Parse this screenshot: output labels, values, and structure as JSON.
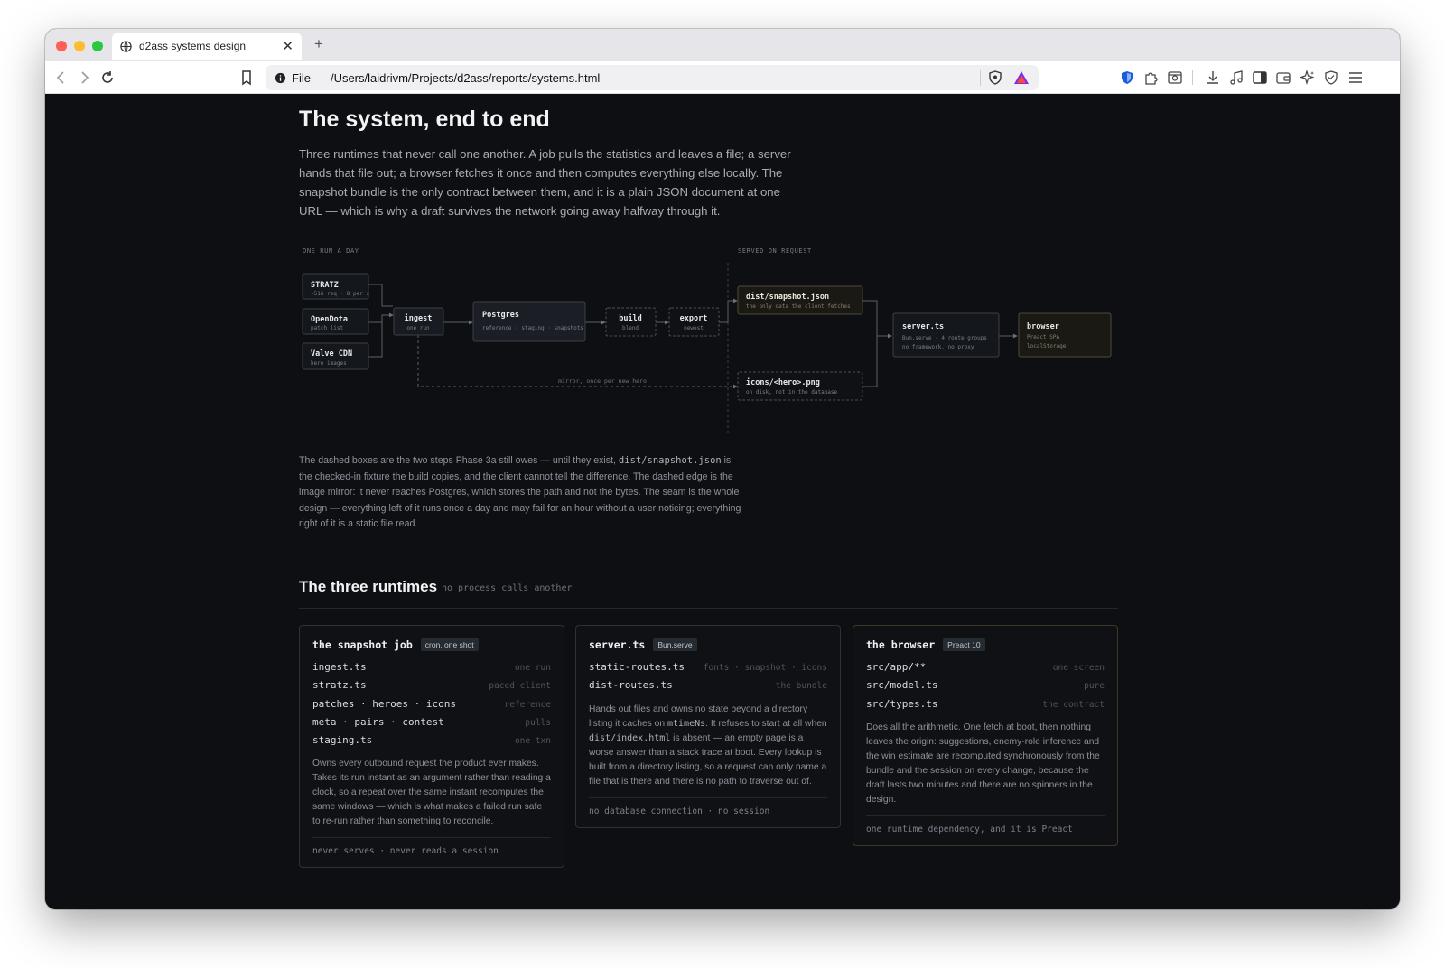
{
  "browser": {
    "tab_title": "d2ass systems design",
    "url_scheme": "File",
    "url": "/Users/laidrivm/Projects/d2ass/reports/systems.html"
  },
  "page": {
    "title": "The system, end to end",
    "lead": "Three runtimes that never call one another. A job pulls the statistics and leaves a file; a server hands that file out; a browser fetches it once and then computes everything else locally. The snapshot bundle is the only contract between them, and it is a plain JSON document at one URL — which is why a draft survives the network going away halfway through it."
  },
  "diagram": {
    "label_left": "ONE RUN A DAY",
    "label_right": "SERVED ON REQUEST",
    "edge_label": "mirror, once per new hero",
    "nodes": {
      "stratz": {
        "title": "STRATZ",
        "sub": "~516 req · 8 per s"
      },
      "opendota": {
        "title": "OpenDota",
        "sub": "patch list"
      },
      "valve": {
        "title": "Valve CDN",
        "sub": "hero images"
      },
      "ingest": {
        "title": "ingest",
        "sub": "one run"
      },
      "postgres": {
        "title": "Postgres",
        "sub": "reference · staging · snapshots"
      },
      "build": {
        "title": "build",
        "sub": "blend"
      },
      "export": {
        "title": "export",
        "sub": "newest"
      },
      "snapshot": {
        "title": "dist/snapshot.json",
        "sub": "the only data the client fetches"
      },
      "icons": {
        "title": "icons/<hero>.png",
        "sub": "on disk, not in the database"
      },
      "server": {
        "title": "server.ts",
        "sub1": "Bun.serve · 4 route groups",
        "sub2": "no framework, no proxy"
      },
      "browser": {
        "title": "browser",
        "sub1": "Preact SPA",
        "sub2": "localStorage"
      }
    }
  },
  "note": {
    "p1": "The dashed boxes are the two steps Phase 3a still owes — until they exist,",
    "code": "dist/snapshot.json",
    "p2": "is the checked-in fixture the build copies, and the client cannot tell the difference. The dashed edge is the image mirror: it never reaches Postgres, which stores the path and not the bytes. The seam is the whole design — everything left of it runs once a day and may fail for an hour without a user noticing; everything right of it is a static file read."
  },
  "runtimes": {
    "heading": "The three runtimes",
    "subheading": "no process calls another",
    "cards": [
      {
        "title": "the snapshot job",
        "badge": "cron, one shot",
        "rows": [
          {
            "k": "ingest.ts",
            "v": "one run"
          },
          {
            "k": "stratz.ts",
            "v": "paced client"
          },
          {
            "k": "patches · heroes · icons",
            "v": "reference"
          },
          {
            "k": "meta · pairs · contest",
            "v": "pulls"
          },
          {
            "k": "staging.ts",
            "v": "one txn"
          }
        ],
        "desc": "Owns every outbound request the product ever makes. Takes its run instant as an argument rather than reading a clock, so a repeat over the same instant recomputes the same windows — which is what makes a failed run safe to re-run rather than something to reconcile.",
        "foot": "never serves · never reads a session"
      },
      {
        "title": "server.ts",
        "badge": "Bun.serve",
        "rows": [
          {
            "k": "static-routes.ts",
            "v": "fonts · snapshot · icons"
          },
          {
            "k": "dist-routes.ts",
            "v": "the bundle"
          }
        ],
        "desc_a": "Hands out files and owns no state beyond a directory listing it caches on ",
        "desc_code1": "mtimeNs",
        "desc_b": ". It refuses to start at all when ",
        "desc_code2": "dist/index.html",
        "desc_c": " is absent — an empty page is a worse answer than a stack trace at boot. Every lookup is built from a directory listing, so a request can only name a file that is there and there is no path to traverse out of.",
        "foot": "no database connection · no session"
      },
      {
        "title": "the browser",
        "badge": "Preact 10",
        "rows": [
          {
            "k": "src/app/**",
            "v": "one screen"
          },
          {
            "k": "src/model.ts",
            "v": "pure"
          },
          {
            "k": "src/types.ts",
            "v": "the contract"
          }
        ],
        "desc": "Does all the arithmetic. One fetch at boot, then nothing leaves the origin: suggestions, enemy-role inference and the win estimate are recomputed synchronously from the bundle and the session on every change, because the draft lasts two minutes and there are no spinners in the design.",
        "foot": "one runtime dependency, and it is Preact"
      }
    ]
  },
  "colors": {
    "page_bg": "#0d0f12",
    "card_border": "#2c3037",
    "accent_card_border": "#3d3825",
    "text_primary": "#f2f3f5",
    "text_muted": "#8d929b"
  },
  "icons": [
    "globe-icon",
    "close-icon",
    "plus-icon",
    "back-icon",
    "forward-icon",
    "reload-icon",
    "bookmark-icon",
    "info-icon",
    "brave-shield-icon",
    "brave-rewards-icon",
    "bitwarden-icon",
    "extensions-icon",
    "screenshot-icon",
    "download-icon",
    "music-icon",
    "sidebar-icon",
    "wallet-icon",
    "leo-ai-icon",
    "vpn-icon",
    "menu-icon"
  ]
}
